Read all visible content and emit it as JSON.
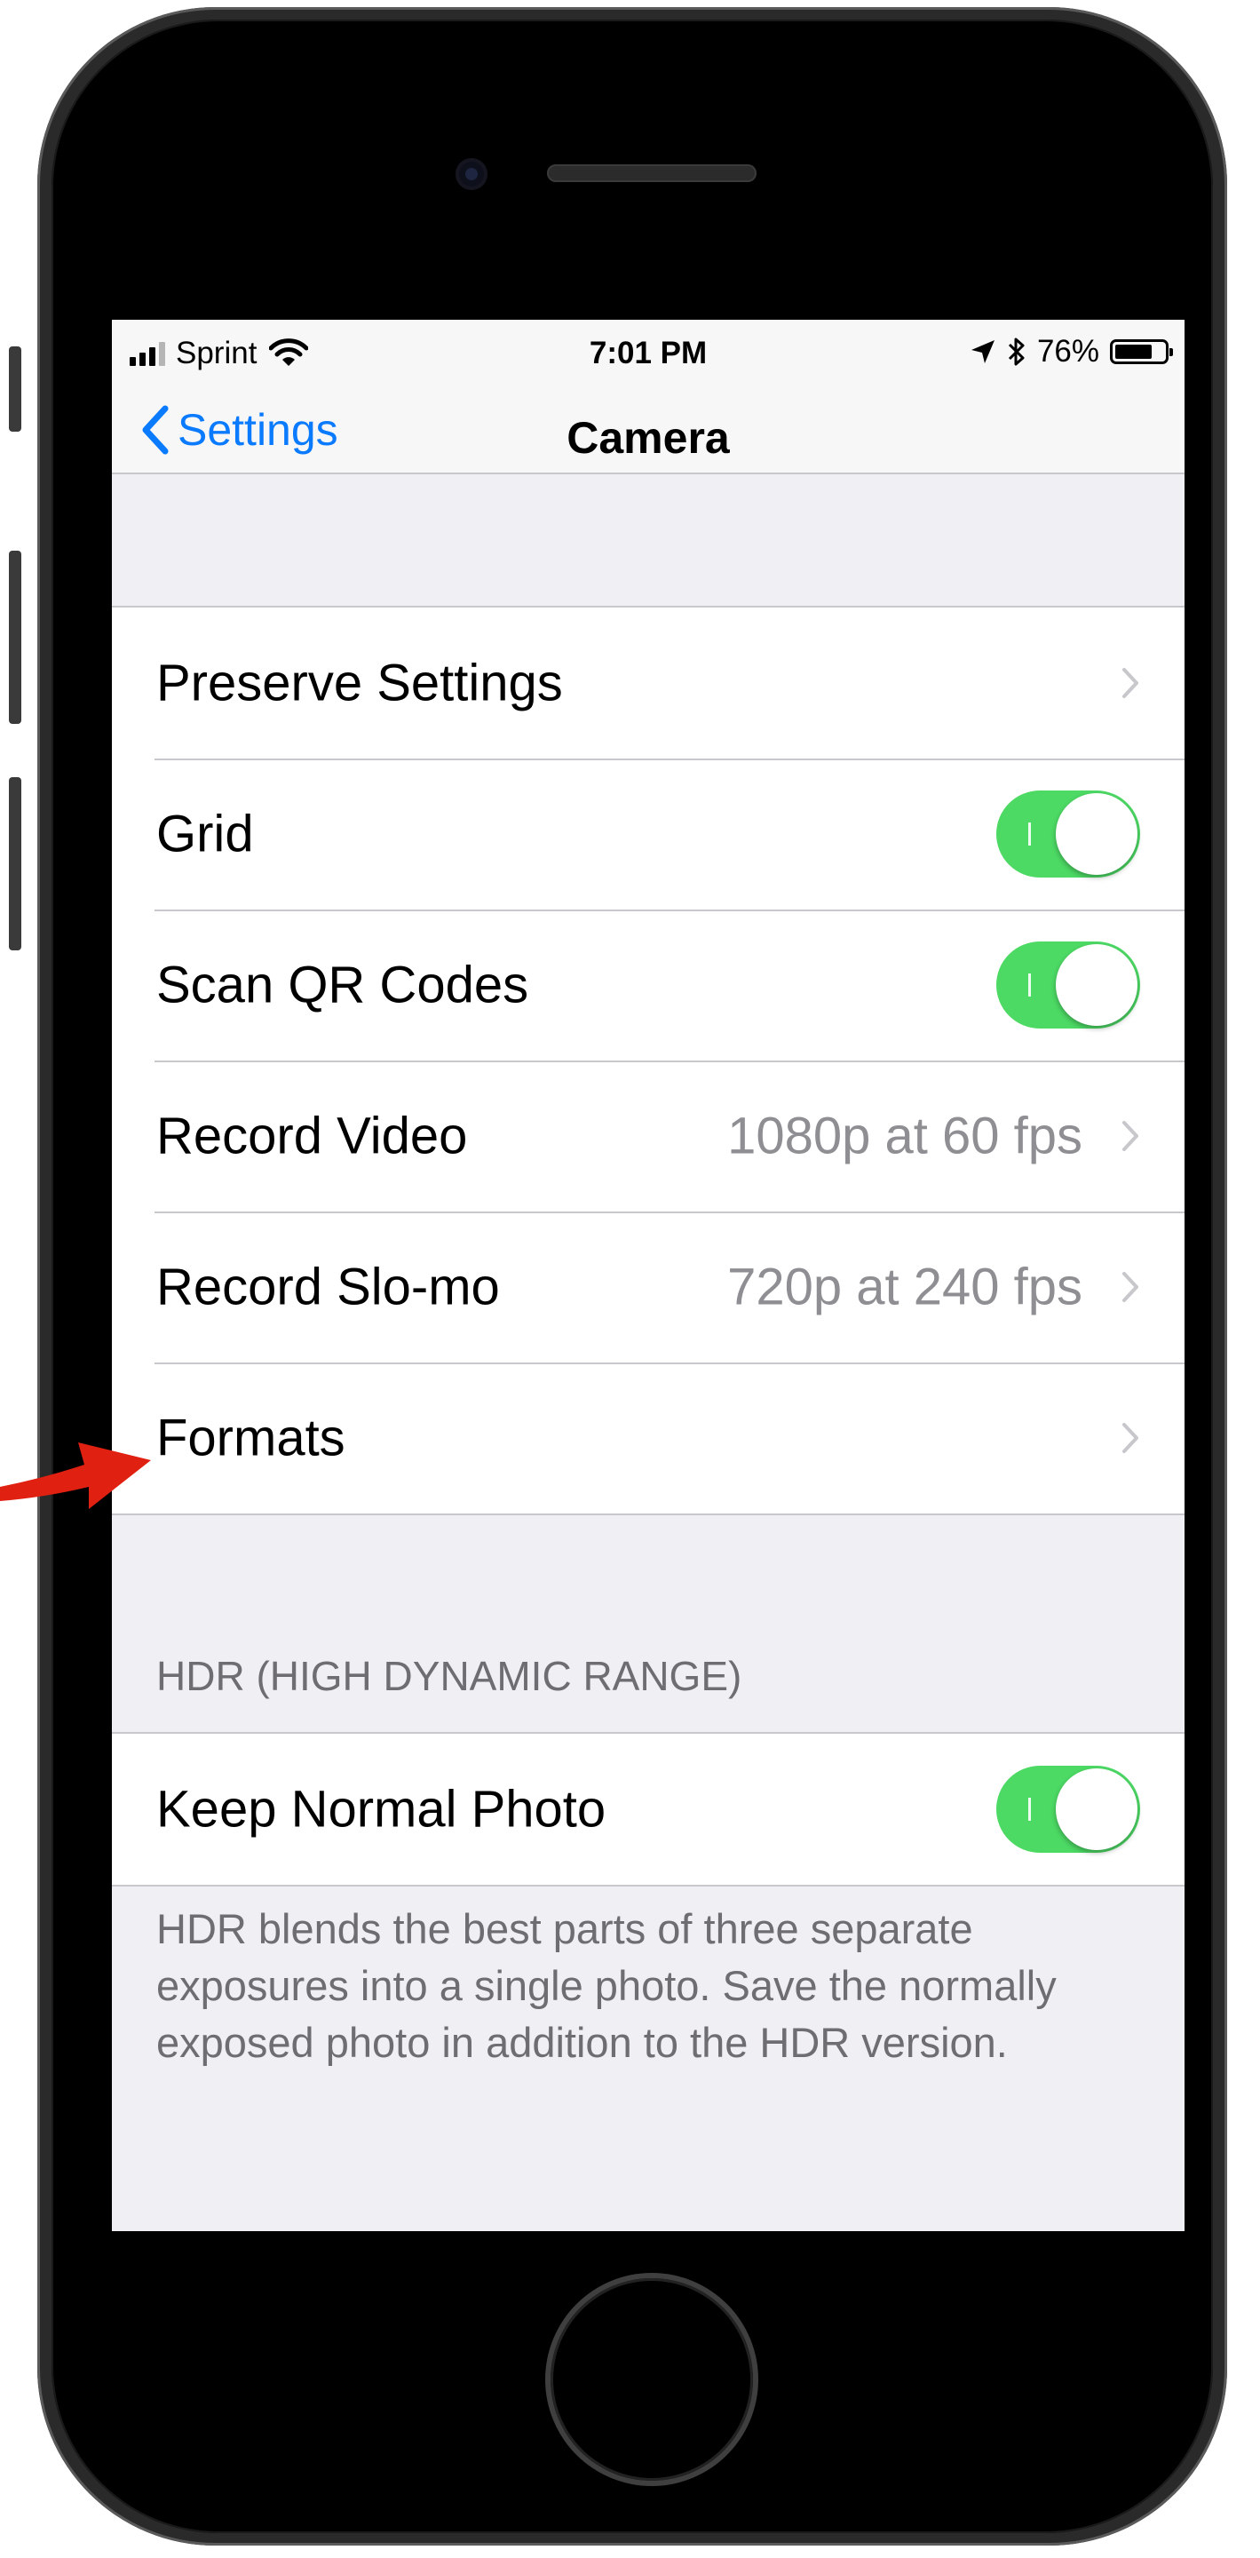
{
  "status": {
    "carrier": "Sprint",
    "time": "7:01 PM",
    "battery": "76%",
    "battery_level": 0.76
  },
  "nav": {
    "back_label": "Settings",
    "title": "Camera"
  },
  "group1": [
    {
      "label": "Preserve Settings",
      "type": "chevron"
    },
    {
      "label": "Grid",
      "type": "toggle",
      "on": true
    },
    {
      "label": "Scan QR Codes",
      "type": "toggle",
      "on": true
    },
    {
      "label": "Record Video",
      "type": "chevron",
      "value": "1080p at 60 fps"
    },
    {
      "label": "Record Slo-mo",
      "type": "chevron",
      "value": "720p at 240 fps"
    },
    {
      "label": "Formats",
      "type": "chevron"
    }
  ],
  "hdr": {
    "header": "HDR (HIGH DYNAMIC RANGE)",
    "row_label": "Keep Normal Photo",
    "row_on": true,
    "footer": "HDR blends the best parts of three separate exposures into a single photo. Save the normally exposed photo in addition to the HDR version."
  },
  "colors": {
    "accent": "#0a7aff",
    "toggle_on": "#4cd964",
    "annotation_arrow": "#e02010"
  },
  "icons": [
    "signal-bars-icon",
    "wifi-icon",
    "location-arrow-icon",
    "bluetooth-icon",
    "battery-icon",
    "back-chevron-icon",
    "chevron-right-icon",
    "annotation-arrow-icon"
  ]
}
